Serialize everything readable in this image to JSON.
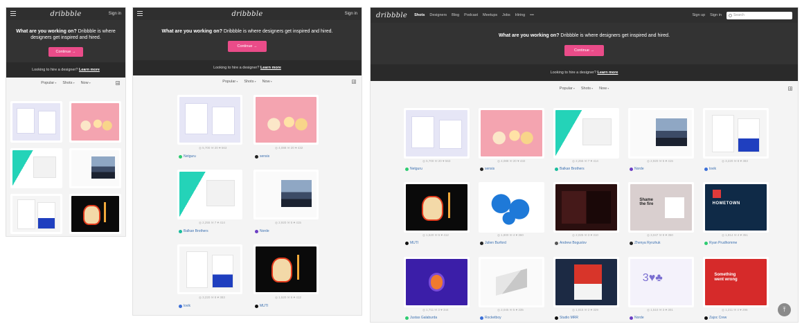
{
  "logo": "dribbble",
  "sign_in": "Sign in",
  "sign_up": "Sign up",
  "hero": {
    "title_bold": "What are you working on?",
    "title_rest": " Dribbble is where designers get inspired and hired.",
    "continue": "Continue →",
    "hire_text": "Looking to hire a designer?",
    "hire_link": "Learn more"
  },
  "filters": {
    "popular": "Popular",
    "shots": "Shots",
    "now": "Now"
  },
  "nav": [
    "Shots",
    "Designers",
    "Blog",
    "Podcast",
    "Meetups",
    "Jobs",
    "Hiring",
    "•••"
  ],
  "search_placeholder": "Search",
  "shots": [
    {
      "author": "Netguru",
      "stats": "◎ 5,700  ✉ 20  ♥ 563",
      "color": "#2ecc71"
    },
    {
      "author": "sensis",
      "stats": "◎ 4,088  ✉ 20  ♥ 432",
      "color": "#222222"
    },
    {
      "author": "Balkan Brothers",
      "stats": "◎ 2,255  ✉ 7  ♥ 414",
      "color": "#1abc9c"
    },
    {
      "author": "Norde",
      "stats": "◎ 2,920  ✉ 5  ♥ 415",
      "color": "#6c3fc4"
    },
    {
      "author": "lovik",
      "stats": "◎ 3,220  ✉ 8  ♥ 383",
      "color": "#3b6fd8"
    },
    {
      "author": "MUTI",
      "stats": "◎ 1,520  ✉ 6  ♥ 412",
      "color": "#111111"
    },
    {
      "author": "Julien Burford",
      "stats": "◎ 1,800  ✉ 4  ♥ 360",
      "color": "#222222"
    },
    {
      "author": "Andrew Boguslov",
      "stats": "◎ 2,025  ✉ 3  ♥ 310",
      "color": "#555555"
    },
    {
      "author": "Zhenya Rynzhuk",
      "stats": "◎ 3,047  ✉ 9  ♥ 350",
      "color": "#222222"
    },
    {
      "author": "Ryan Prudhomme",
      "stats": "◎ 1,914  ✉ 4  ♥ 351",
      "color": "#2ecc71"
    },
    {
      "author": "Justas Galaburda",
      "stats": "◎ 1,711  ✉ 3  ♥ 344",
      "color": "#2ecc71"
    },
    {
      "author": "Rocketboy",
      "stats": "◎ 2,045  ✉ 5  ♥ 335",
      "color": "#3b6fd8"
    },
    {
      "author": "Studio MRR",
      "stats": "◎ 1,815  ✉ 2  ♥ 329",
      "color": "#111111"
    },
    {
      "author": "Norde",
      "stats": "◎ 1,510  ✉ 3  ♥ 301",
      "color": "#6c3fc4"
    },
    {
      "author": "Zajoc Crew",
      "stats": "◎ 1,211  ✉ 4  ♥ 296",
      "color": "#111111"
    }
  ]
}
